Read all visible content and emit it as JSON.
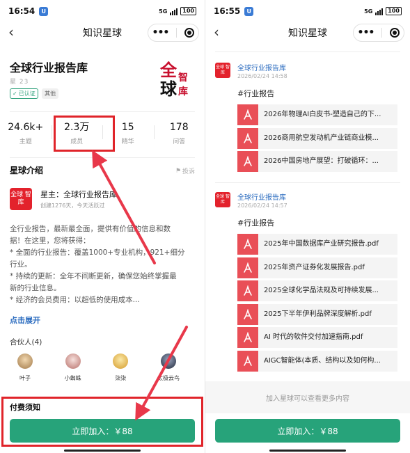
{
  "left": {
    "status": {
      "time": "16:54",
      "network": "5G",
      "battery": "100"
    },
    "nav": {
      "title": "知识星球"
    },
    "planet": {
      "name": "全球行业报告库",
      "id_partial": "星        23",
      "verified": "已认证",
      "tag": "其他",
      "logo_chars": [
        "全",
        "球",
        "智",
        "库"
      ]
    },
    "stats": [
      {
        "value": "24.6k+",
        "label": "主题"
      },
      {
        "value": "2.3万",
        "label": "成员"
      },
      {
        "value": "15",
        "label": "精华"
      },
      {
        "value": "178",
        "label": "问答"
      }
    ],
    "intro": {
      "title": "星球介绍",
      "report": "投诉",
      "owner_avatar_text": "全球 智库",
      "owner": "星主：全球行业报告库",
      "owner_meta": "创建1276天，今天活跃过",
      "lines": [
        "全行业报告，最新最全面，提供有价值的信息和数",
        "据！在这里，您将获得：",
        "* 全面的行业报告：覆盖1000+专业机构，921+细分",
        "行业。",
        "* 持续的更新：全年不间断更新，确保您始终掌握最",
        "新的行业信息。",
        "* 经济的会员费用：以超低的使用成本..."
      ],
      "expand": "点击展开"
    },
    "partners": {
      "title": "合伙人(4)",
      "items": [
        {
          "name": "叶子",
          "color": "#c8a070"
        },
        {
          "name": "小蜘蛛",
          "color": "#d9a3a0"
        },
        {
          "name": "柒柒",
          "color": "#e6b95a"
        },
        {
          "name": "太极云鸟",
          "color": "#3a4a66"
        }
      ]
    },
    "notice": "付费须知",
    "join": "立即加入：￥88"
  },
  "right": {
    "status": {
      "time": "16:55",
      "network": "5G",
      "battery": "100"
    },
    "nav": {
      "title": "知识星球"
    },
    "posts": [
      {
        "avatar_text": "全球 智库",
        "author": "全球行业报告库",
        "date": "2026/02/24 14:58",
        "tag": "#行业报告",
        "files": [
          "2026年物理AI白皮书-塑造自己的下...",
          "2026商用航空发动机产业链商业模...",
          "2026中国房地产展望：打破循环：..."
        ]
      },
      {
        "avatar_text": "全球 智库",
        "author": "全球行业报告库",
        "date": "2026/02/24 14:57",
        "tag": "#行业报告",
        "files": [
          "2025年中国数据库产业研究报告.pdf",
          "2025年资产证券化发展报告.pdf",
          "2025全球化学品法规及可持续发展...",
          "2025下半年伊利品牌深度解析.pdf",
          "AI 时代的软件交付加速指南.pdf",
          "AIGC智能体(本质、结构以及如何构..."
        ]
      }
    ],
    "more": "加入星球可以查看更多内容",
    "join": "立即加入：￥88"
  },
  "colors": {
    "brand_green": "#27a37a",
    "highlight_red": "#e0242a",
    "pdf_red": "#e94f57",
    "link_blue": "#2a6bbf"
  }
}
